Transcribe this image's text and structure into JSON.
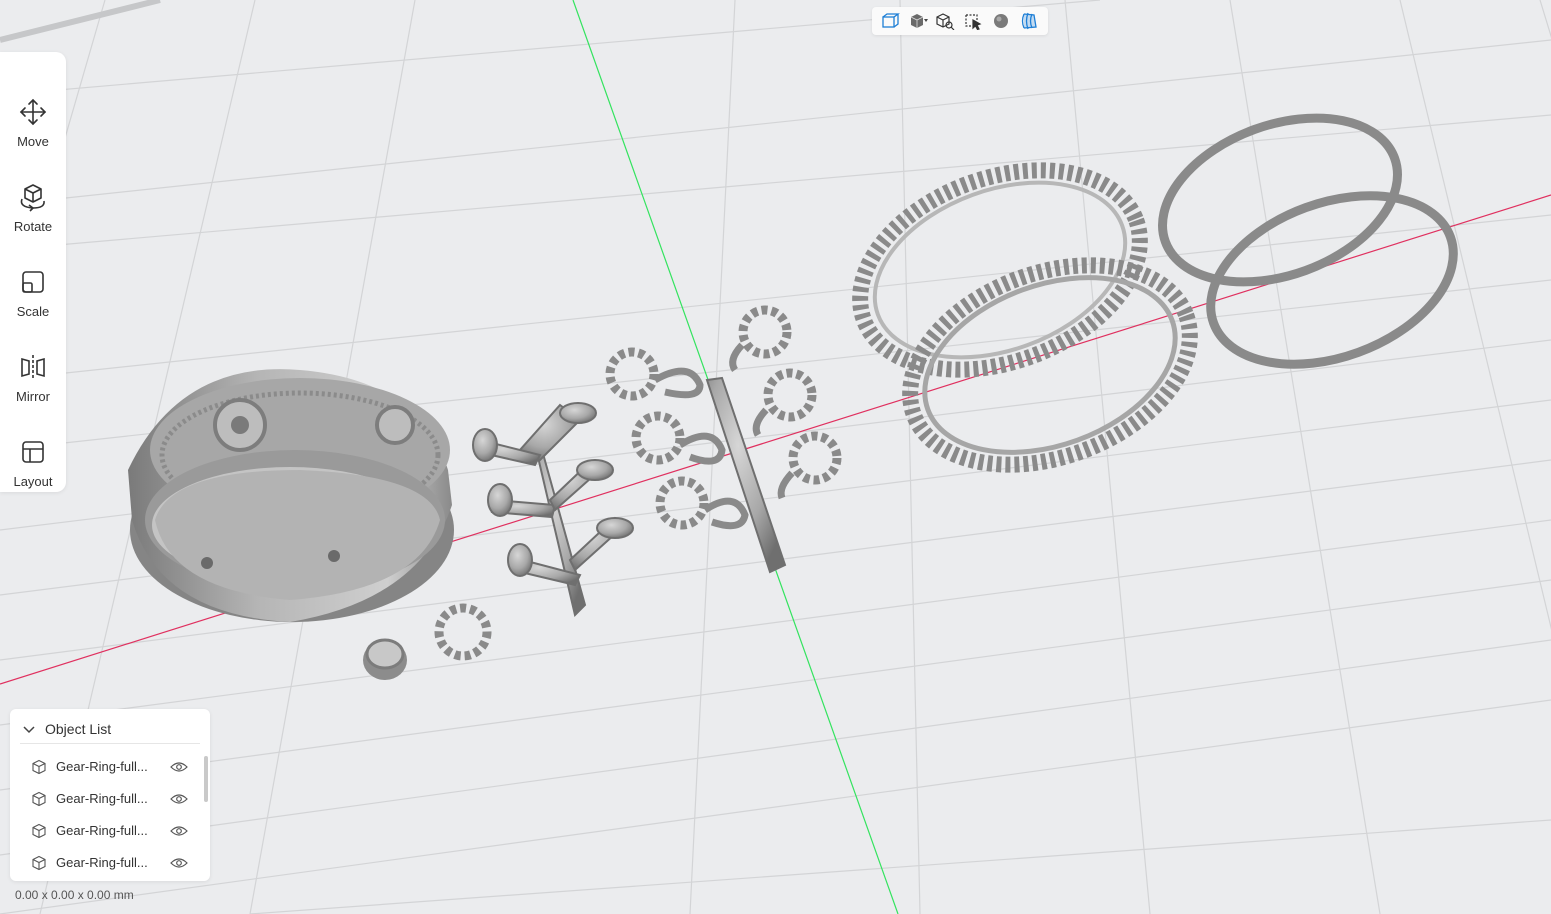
{
  "toolbar": {
    "tools": [
      {
        "label": "Move",
        "icon": "move-icon"
      },
      {
        "label": "Rotate",
        "icon": "rotate-icon"
      },
      {
        "label": "Scale",
        "icon": "scale-icon"
      },
      {
        "label": "Mirror",
        "icon": "mirror-icon"
      },
      {
        "label": "Layout",
        "icon": "layout-icon"
      }
    ]
  },
  "view_tools": [
    {
      "icon": "wireframe-box-icon"
    },
    {
      "icon": "solid-cube-dropdown-icon"
    },
    {
      "icon": "cube-zoom-icon"
    },
    {
      "icon": "select-cursor-icon"
    },
    {
      "icon": "material-sphere-icon"
    },
    {
      "icon": "xray-shell-icon"
    }
  ],
  "object_list": {
    "title": "Object List",
    "items": [
      {
        "name": "Gear-Ring-full..."
      },
      {
        "name": "Gear-Ring-full..."
      },
      {
        "name": "Gear-Ring-full..."
      },
      {
        "name": "Gear-Ring-full..."
      }
    ]
  },
  "dimensions": "0.00 x 0.00 x 0.00 mm",
  "colors": {
    "background": "#ebecee",
    "grid": "#d3d4d6",
    "x_axis": "#e0305f",
    "y_axis": "#33e35e",
    "model": "#9c9c9c",
    "accent": "#1e7fd6"
  }
}
